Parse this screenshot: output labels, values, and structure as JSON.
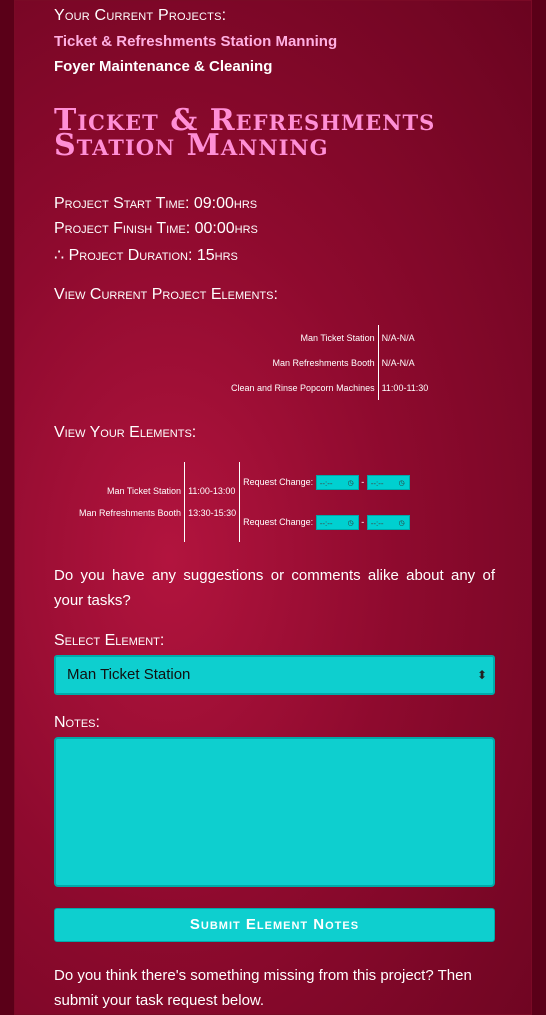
{
  "projects": {
    "heading": "Your Current Projects:",
    "items": [
      "Ticket & Refreshments Station Manning",
      "Foyer Maintenance & Cleaning"
    ]
  },
  "project": {
    "title": "Ticket & Refreshments Station Manning",
    "start": "Project Start Time: 09:00hrs",
    "finish": "Project Finish Time: 00:00hrs",
    "duration": "∴ Project Duration: 15hrs"
  },
  "project_elements": {
    "heading": "View Current Project Elements:",
    "rows": [
      {
        "name": "Man Ticket Station",
        "time": "N/A-N/A"
      },
      {
        "name": "Man Refreshments Booth",
        "time": "N/A-N/A"
      },
      {
        "name": "Clean and Rinse Popcorn Machines",
        "time": "11:00-11:30"
      }
    ]
  },
  "your_elements": {
    "heading": "View Your Elements:",
    "rows": [
      {
        "name": "Man Ticket Station",
        "time": "11:00-13:00"
      },
      {
        "name": "Man Refreshments Booth",
        "time": "13:30-15:30"
      }
    ],
    "request_label": "Request Change:",
    "time_placeholder": "--:--",
    "separator": "-"
  },
  "suggestions": {
    "question": "Do you have any suggestions or comments alike about any of your tasks?",
    "select_label": "Select Element:",
    "select_value": "Man Ticket Station",
    "notes_label": "Notes:",
    "submit_label": "Submit Element Notes"
  },
  "missing": {
    "question": "Do you think there's something missing from this project? Then submit your task request below."
  },
  "colors": {
    "background": "#8e0a2e",
    "accent": "#ff8fd6",
    "input": "#0ecfcf"
  }
}
